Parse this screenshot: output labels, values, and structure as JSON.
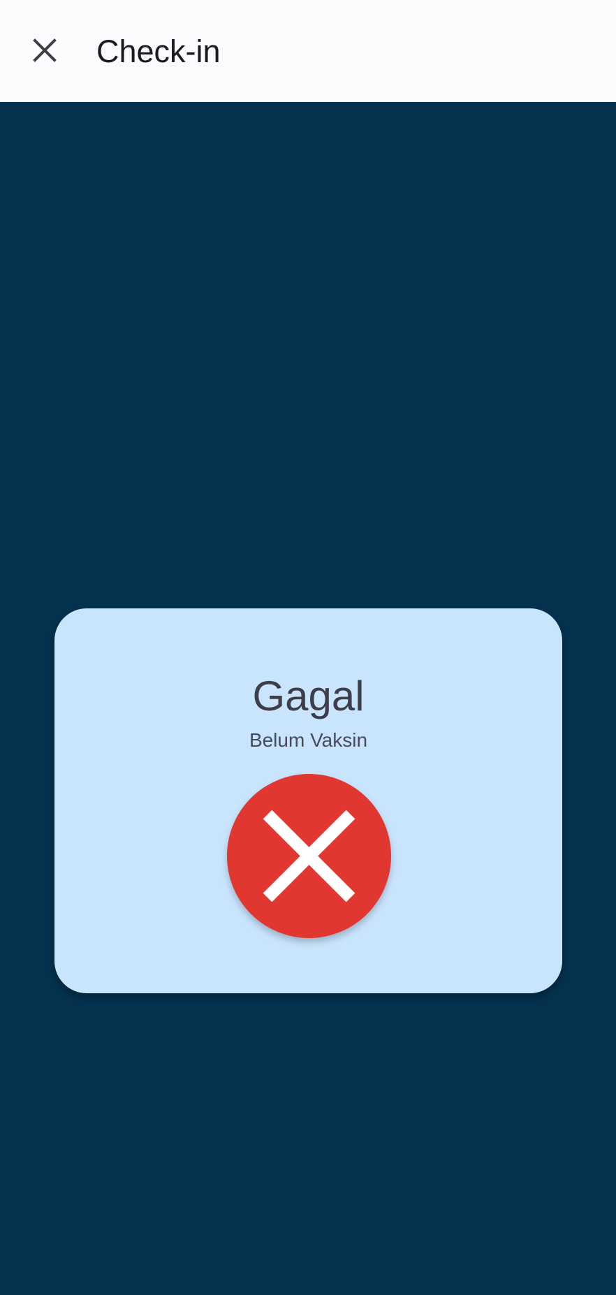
{
  "app_bar": {
    "title": "Check-in",
    "close_icon": "close-icon"
  },
  "result": {
    "status": "Gagal",
    "message": "Belum Vaksin",
    "status_icon": "error-x-icon"
  },
  "colors": {
    "app_bar_background": "#FBFBFE",
    "page_background": "#04324F",
    "card_background": "#C9E5FD",
    "error_red": "#E03730",
    "text_dark": "#3E3D4A"
  }
}
